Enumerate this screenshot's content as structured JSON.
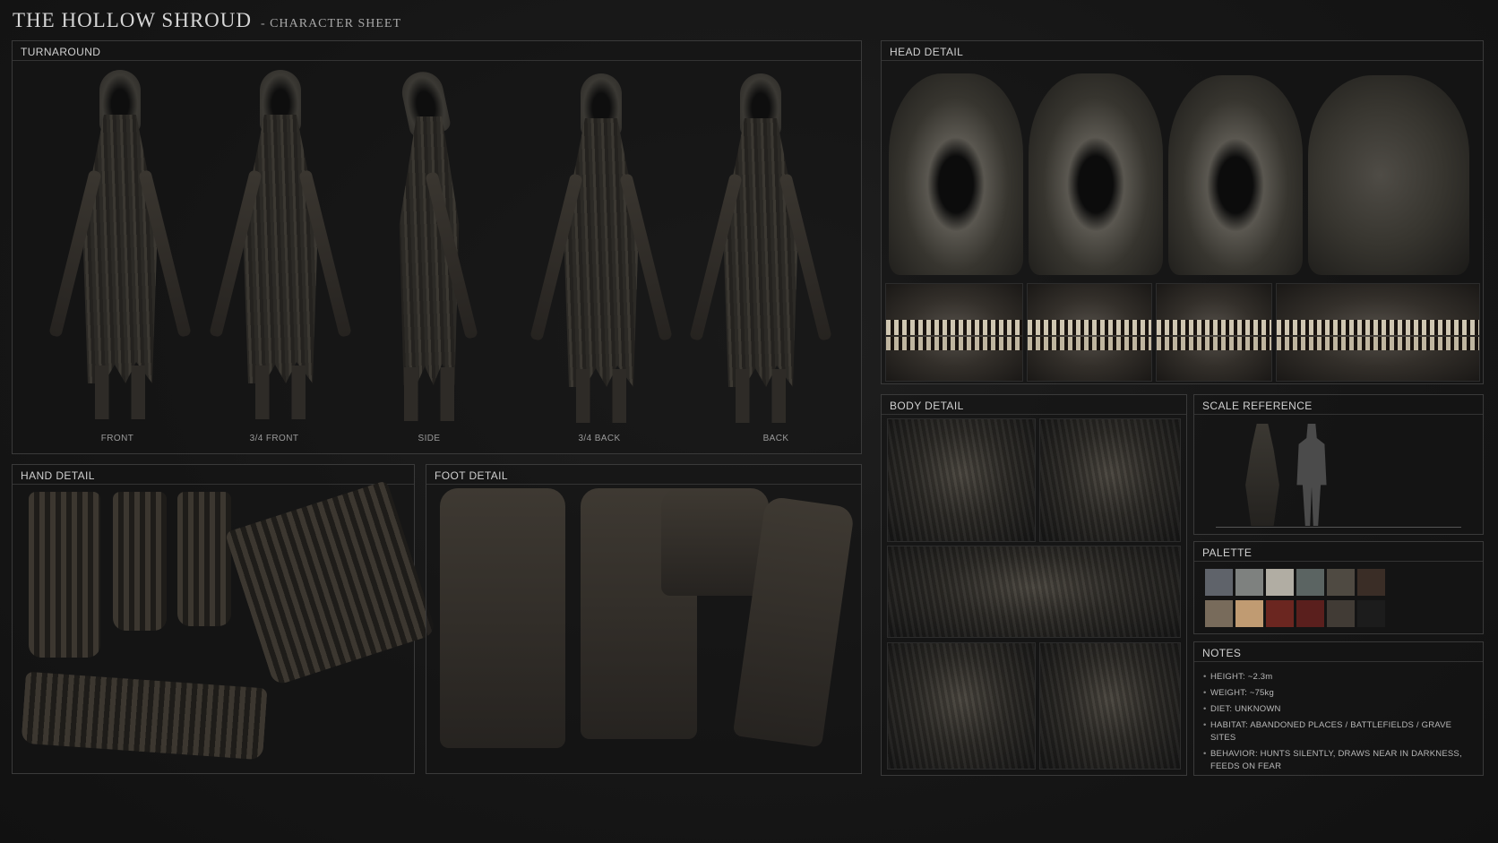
{
  "title": "THE HOLLOW SHROUD",
  "subtitle": "- CHARACTER SHEET",
  "panels": {
    "turnaround": "TURNAROUND",
    "head_detail": "HEAD DETAIL",
    "hand_detail": "HAND DETAIL",
    "foot_detail": "FOOT DETAIL",
    "body_detail": "BODY DETAIL",
    "scale_reference": "SCALE REFERENCE",
    "palette": "PALETTE",
    "notes": "NOTES"
  },
  "views": [
    "FRONT",
    "3/4 FRONT",
    "SIDE",
    "3/4 BACK",
    "BACK"
  ],
  "palette_colors": [
    "#5f636a",
    "#7e817f",
    "#b1ada3",
    "#5b6462",
    "#4f4a42",
    "#3a2d26",
    "#786b5b",
    "#c09b72",
    "#6b2620",
    "#5a1f1d",
    "#413b35",
    "#1c1c1c"
  ],
  "notes": [
    "HEIGHT: ~2.3m",
    "WEIGHT: ~75kg",
    "DIET: UNKNOWN",
    "HABITAT: ABANDONED PLACES / BATTLEFIELDS / GRAVE SITES",
    "BEHAVIOR: HUNTS SILENTLY, DRAWS NEAR IN DARKNESS, FEEDS ON FEAR"
  ]
}
